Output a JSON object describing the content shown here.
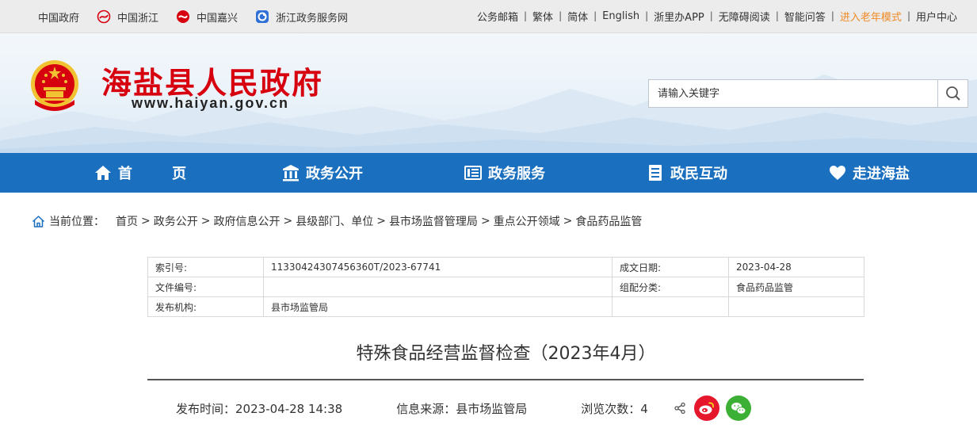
{
  "topbar": {
    "left_links": [
      {
        "label": "中国政府",
        "icon": "none"
      },
      {
        "label": "中国浙江",
        "icon": "zhejiang-logo-icon"
      },
      {
        "label": "中国嘉兴",
        "icon": "jiaxing-logo-icon"
      },
      {
        "label": "浙江政务服务网",
        "icon": "zjzwfw-logo-icon"
      }
    ],
    "right_links": [
      "公务邮箱",
      "繁体",
      "简体",
      "English",
      "浙里办APP",
      "无障碍阅读",
      "智能问答",
      "进入老年模式",
      "用户中心"
    ],
    "separator": "|",
    "accent_color": "#f08a24"
  },
  "header": {
    "site_title": "海盐县人民政府",
    "site_url": "www.haiyan.gov.cn",
    "title_color": "#d7000f"
  },
  "search": {
    "placeholder": "请输入关键字"
  },
  "nav": {
    "color": "#1a6fbf",
    "items": [
      {
        "label": "首 页",
        "icon": "home-icon"
      },
      {
        "label": "政务公开",
        "icon": "building-icon"
      },
      {
        "label": "政务服务",
        "icon": "list-icon"
      },
      {
        "label": "政民互动",
        "icon": "document-icon"
      },
      {
        "label": "走进海盐",
        "icon": "heart-icon"
      }
    ]
  },
  "breadcrumb": {
    "label": "当前位置：",
    "items": [
      "首页",
      "政务公开",
      "政府信息公开",
      "县级部门、单位",
      "县市场监督管理局",
      "重点公开领域",
      "食品药品监管"
    ],
    "separator": ">"
  },
  "meta": {
    "index_key": "索引号:",
    "index_val": "11330424307456360T/2023-67741",
    "date_key": "成文日期:",
    "date_val": "2023-04-28",
    "docno_key": "文件编号:",
    "docno_val": "",
    "category_key": "组配分类:",
    "category_val": "食品药品监管",
    "publisher_key": "发布机构:",
    "publisher_val": "县市场监管局",
    "empty_key": "",
    "empty_val": ""
  },
  "article": {
    "title": "特殊食品经营监督检查（2023年4月）",
    "publish_label": "发布时间：",
    "publish_time": "2023-04-28 14:38",
    "source_label": "信息来源：",
    "source": "县市场监管局",
    "views_label": "浏览次数：",
    "views": "4"
  }
}
